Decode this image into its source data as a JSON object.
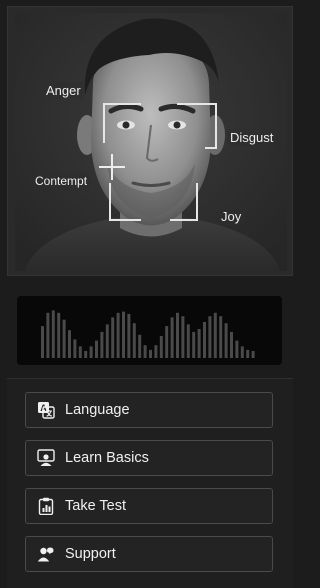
{
  "emotions": {
    "anger": "Anger",
    "disgust": "Disgust",
    "contempt": "Contempt",
    "joy": "Joy"
  },
  "audio": {
    "bar_levels": [
      0.55,
      0.78,
      0.82,
      0.78,
      0.66,
      0.48,
      0.32,
      0.2,
      0.12,
      0.2,
      0.3,
      0.45,
      0.58,
      0.7,
      0.78,
      0.8,
      0.76,
      0.6,
      0.4,
      0.22,
      0.14,
      0.22,
      0.38,
      0.55,
      0.7,
      0.78,
      0.72,
      0.58,
      0.45,
      0.5,
      0.62,
      0.72,
      0.78,
      0.72,
      0.6,
      0.45,
      0.3,
      0.2,
      0.14,
      0.12
    ]
  },
  "menu": [
    {
      "label": "Language",
      "icon": "language-icon"
    },
    {
      "label": "Learn Basics",
      "icon": "learn-icon"
    },
    {
      "label": "Take Test",
      "icon": "clipboard-chart-icon"
    },
    {
      "label": "Support",
      "icon": "support-icon"
    }
  ],
  "colors": {
    "background": "#1c1c1c",
    "panel": "#2a2a2a",
    "waveform": "#4a4a4a",
    "button_border": "#4a4a4a"
  }
}
